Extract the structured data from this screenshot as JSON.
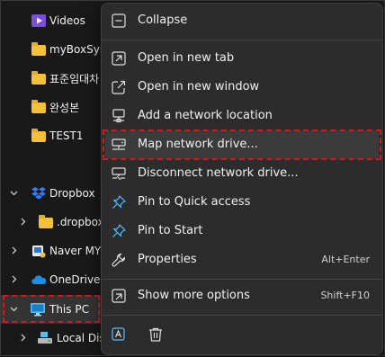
{
  "tree": {
    "items": [
      {
        "label": "Videos",
        "icon": "videos-folder-icon"
      },
      {
        "label": "myBoxSyn",
        "icon": "folder-icon"
      },
      {
        "label": "표준임대차",
        "icon": "folder-icon"
      },
      {
        "label": "완성본",
        "icon": "folder-icon"
      },
      {
        "label": "TEST1",
        "icon": "folder-icon"
      },
      {
        "label": "Dropbox",
        "icon": "dropbox-icon"
      },
      {
        "label": ".dropbox",
        "icon": "folder-icon"
      },
      {
        "label": "Naver MYI",
        "icon": "naver-mybox-icon"
      },
      {
        "label": "OneDrive -",
        "icon": "onedrive-icon"
      },
      {
        "label": "This PC",
        "icon": "computer-icon"
      },
      {
        "label": "Local Dis",
        "icon": "local-disk-icon"
      }
    ]
  },
  "menu": {
    "collapse": "Collapse",
    "open_new_tab": "Open in new tab",
    "open_new_window": "Open in new window",
    "add_network_location": "Add a network location",
    "map_network_drive": "Map network drive...",
    "disconnect_network_drive": "Disconnect network drive...",
    "pin_quick_access": "Pin to Quick access",
    "pin_start": "Pin to Start",
    "properties": "Properties",
    "properties_shortcut": "Alt+Enter",
    "show_more_options": "Show more options",
    "show_more_shortcut": "Shift+F10"
  },
  "colors": {
    "highlight": "#d11a1a",
    "menu_bg": "#2c2c2c",
    "accent_blue": "#4cc2ff"
  }
}
